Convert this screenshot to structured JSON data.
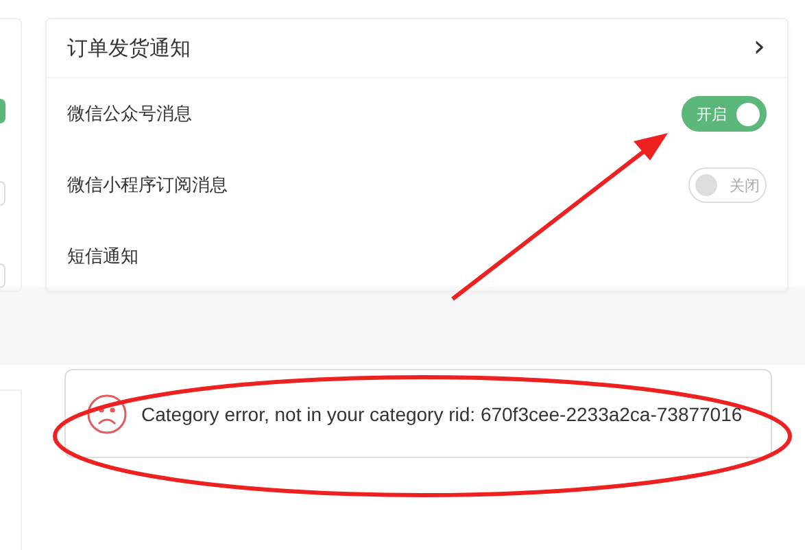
{
  "side_card": {
    "toggles": [
      {
        "on": true
      },
      {
        "on": false
      },
      {
        "on": false
      }
    ]
  },
  "card": {
    "title": "订单发货通知",
    "chevron": "›",
    "rows": [
      {
        "label": "微信公众号消息",
        "kind": "toggle",
        "on": true,
        "toggle_text": "开启"
      },
      {
        "label": "微信小程序订阅消息",
        "kind": "toggle",
        "on": false,
        "toggle_text": "关闭"
      },
      {
        "label": "短信通知",
        "kind": "plain"
      }
    ]
  },
  "toast": {
    "message": "Category error, not in your category rid: 670f3cee-2233a2ca-73877016"
  }
}
